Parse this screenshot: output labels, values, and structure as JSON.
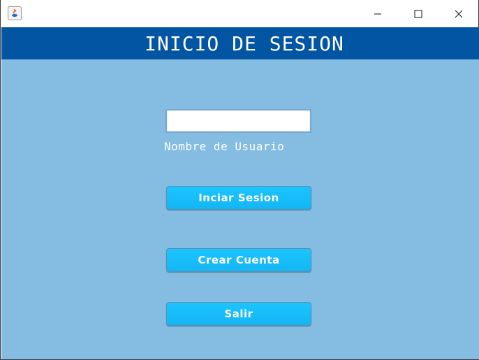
{
  "window": {
    "controls": {
      "minimize_icon": "minimize-icon",
      "maximize_icon": "maximize-icon",
      "close_icon": "close-icon"
    },
    "app_icon": "java-icon"
  },
  "header": {
    "title": "INICIO DE SESION",
    "background": "#0255a3"
  },
  "form": {
    "background": "#85bce1",
    "username": {
      "value": "",
      "label": "Nombre de Usuario"
    },
    "buttons": {
      "login": "Inciar Sesion",
      "create_account": "Crear Cuenta",
      "exit": "Salir"
    },
    "button_color": "#1cc4ff"
  }
}
